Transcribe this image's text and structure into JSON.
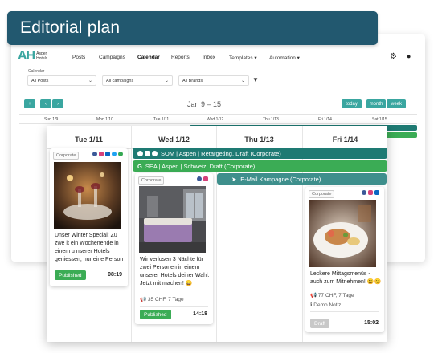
{
  "banner": {
    "title": "Editorial plan"
  },
  "app": {
    "logo": {
      "mark": "AH",
      "name_line1": "Aspen",
      "name_line2": "Hotels"
    },
    "nav": [
      "Posts",
      "Campaigns",
      "Calendar",
      "Reports",
      "Inbox",
      "Templates ▾",
      "Automation ▾"
    ],
    "active_nav": "Calendar",
    "filters_label": "Calendar",
    "filters": {
      "posts": "All Posts",
      "campaigns": "All campaigns",
      "brands": "All Brands"
    },
    "toolbar": {
      "add": "+",
      "prev": "‹",
      "next": "›",
      "range_title": "Jan 9 – 15",
      "today": "today",
      "month": "month",
      "week": "week"
    },
    "bg_days": [
      "Sun 1/9",
      "Mon 1/10",
      "Tue 1/11",
      "Wed 1/12",
      "Thu 1/13",
      "Fri 1/14",
      "Sat 1/15"
    ]
  },
  "calendar": {
    "days": [
      "Tue 1/11",
      "Wed 1/12",
      "Thu 1/13",
      "Fri 1/14"
    ],
    "span_bars": [
      {
        "label": "SOM | Aspen | Retargeting, Draft (Corporate)",
        "color": "#1e7a73"
      },
      {
        "label": "SEA | Aspen | Schweiz, Draft (Corporate)",
        "color": "#3bac55"
      },
      {
        "label": "E-Mail Kampagne (Corporate)",
        "color": "#3e8f8c"
      }
    ],
    "posts": [
      {
        "badge": "Corporate",
        "text": "Unser Winter Special: Zu zwe it ein Wochenende in einem u nserer Hotels geniessen, nur eine Person bez...",
        "status": "Published",
        "status_color": "#3bac55",
        "time": "08:19"
      },
      {
        "badge": "Corporate",
        "text": "Wir verlosen 3 Nächte für zwei Personen in einem unserer Hotels deiner Wahl. Jetzt mit machen! 😀",
        "meta": "35 CHF, 7 Tage",
        "status": "Published",
        "status_color": "#3bac55",
        "time": "14:18"
      },
      {
        "badge": "Corporate",
        "text": "Leckere Mittagsmenüs - auch zum Mitnehmen! 😀😊",
        "meta": "77 CHF, 7 Tage",
        "note": "Demo Notiz",
        "status": "Draft",
        "status_color": "#c8c8c8",
        "time": "15:02"
      }
    ]
  },
  "colors": {
    "banner": "#22586f",
    "accent": "#3aa6a0",
    "facebook": "#3b5998",
    "instagram": "#d6417a",
    "linkedin": "#0a66c2",
    "twitter": "#1da1f2",
    "google": "#34a853"
  }
}
